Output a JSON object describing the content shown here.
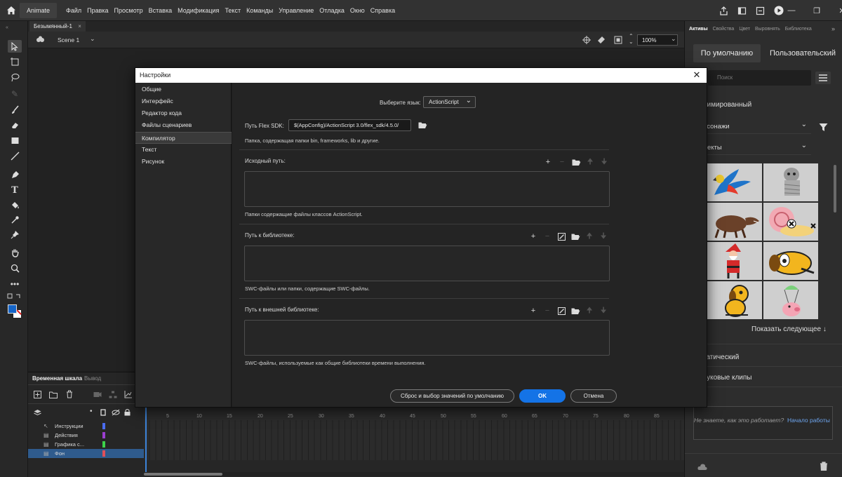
{
  "menubar": {
    "app_name": "Animate",
    "items": [
      "Файл",
      "Правка",
      "Просмотр",
      "Вставка",
      "Модификация",
      "Текст",
      "Команды",
      "Управление",
      "Отладка",
      "Окно",
      "Справка"
    ]
  },
  "document": {
    "tab_title": "Безымянный-1",
    "scene_label": "Scene 1",
    "zoom": "100%"
  },
  "timeline": {
    "tab_timeline": "Временная шкала",
    "tab_output": "Вывод",
    "frame_numbers": [
      "5",
      "10",
      "15",
      "20",
      "25",
      "30",
      "35",
      "40",
      "45",
      "50",
      "55",
      "60",
      "65",
      "70",
      "75",
      "80",
      "85"
    ],
    "layers": [
      {
        "name": "Инструкции",
        "color": "#4a6cf0"
      },
      {
        "name": "Действия",
        "color": "#9b3fd0"
      },
      {
        "name": "Графика с...",
        "color": "#3dd24a"
      },
      {
        "name": "Фон",
        "color": "#e0505a"
      }
    ]
  },
  "right_panel": {
    "tabs": [
      "Активы",
      "Свойства",
      "Цвет",
      "Выровнять",
      "Библиотека"
    ],
    "btn_default": "По умолчанию",
    "btn_custom": "Пользовательский",
    "search_placeholder": "Поиск",
    "section_animated": "нимированный",
    "dropdown_characters": "рсонажи",
    "dropdown_objects": "ъекты",
    "show_next": "Показать следующее",
    "section_static": "татический",
    "section_sound": "вуковые клипы",
    "help_text": "Не знаете, как это работает?",
    "help_link": "Начало работы"
  },
  "dialog": {
    "title": "Настройки",
    "sidebar": [
      "Общие",
      "Интерфейс",
      "Редактор кода",
      "Файлы сценариев",
      "Компилятор",
      "Текст",
      "Рисунок"
    ],
    "selected_index": 4,
    "language_label": "Выберите язык:",
    "language_value": "ActionScript",
    "flex_sdk_label": "Путь Flex SDK:",
    "flex_sdk_value": "$(AppConfig)/ActionScript 3.0/flex_sdk/4.5.0/",
    "flex_sdk_hint": "Папка, содержащая папки bin, frameworks, lib и другие.",
    "source_path_label": "Исходный путь:",
    "source_path_hint": "Папки содержащие файлы классов ActionScript.",
    "library_path_label": "Путь к библиотеке:",
    "library_path_hint": "SWC-файлы или папки, содержащие SWC-файлы.",
    "external_library_label": "Путь к внешней библиотеке:",
    "external_library_hint": "SWC-файлы, используемые как общие библиотеки времени выполнения.",
    "btn_reset": "Сброс и выбор значений по умолчанию",
    "btn_ok": "OK",
    "btn_cancel": "Отмена"
  },
  "colors": {
    "accent": "#1473e6",
    "dialog_bg": "#242424",
    "app_bg": "#1e1e1e"
  }
}
